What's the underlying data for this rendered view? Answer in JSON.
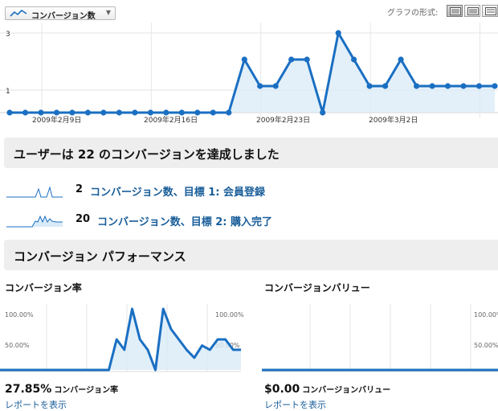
{
  "toolbar": {
    "metric_label": "コンバージョン数",
    "graph_type_label": "グラフの形式:"
  },
  "main_chart": {
    "y_ticks": [
      "3",
      "1"
    ],
    "x_ticks": [
      "2009年2月9日",
      "2009年2月16日",
      "2009年2月23日",
      "2009年3月2日"
    ]
  },
  "summary": {
    "heading": "ユーザーは 22 のコンバージョンを達成しました",
    "goals": [
      {
        "count": "2",
        "label": "コンバージョン数、目標 1: 会員登録"
      },
      {
        "count": "20",
        "label": "コンバージョン数、目標 2: 購入完了"
      }
    ]
  },
  "performance": {
    "heading": "コンバージョン パフォーマンス",
    "rate": {
      "title": "コンバージョン率",
      "tick_top": "100.00%",
      "tick_mid": "50.00%",
      "value": "27.85%",
      "unit": "コンバージョン率",
      "link": "レポートを表示"
    },
    "value": {
      "title": "コンバージョンバリュー",
      "tick_top": "100.00%",
      "tick_mid": "50.00%",
      "value": "$0.00",
      "unit": "コンバージョンバリュー",
      "link": "レポートを表示"
    }
  },
  "chart_data": [
    {
      "type": "area",
      "title": "",
      "xlabel": "",
      "ylabel": "",
      "x_tick_labels": [
        "2009年2月9日",
        "2009年2月16日",
        "2009年2月23日",
        "2009年3月2日"
      ],
      "ylim": [
        0,
        3
      ],
      "series": [
        {
          "values": [
            0,
            0,
            0,
            0,
            0,
            0,
            0,
            0,
            0,
            0,
            0,
            0,
            0,
            0,
            0,
            2,
            1,
            1,
            2,
            2,
            0,
            3,
            2,
            1,
            1,
            2,
            1,
            1,
            1,
            1,
            1,
            1
          ]
        }
      ]
    },
    {
      "type": "area",
      "title": "コンバージョン率",
      "ylim": [
        0,
        100
      ],
      "y_tick_labels": [
        "100.00%",
        "50.00%"
      ],
      "series": [
        {
          "values": [
            0,
            0,
            0,
            0,
            0,
            0,
            0,
            0,
            0,
            0,
            0,
            0,
            0,
            0,
            0,
            50,
            33,
            100,
            50,
            33,
            0,
            100,
            67,
            50,
            33,
            20,
            40,
            33,
            50,
            50,
            33,
            33
          ]
        }
      ]
    },
    {
      "type": "area",
      "title": "コンバージョンバリュー",
      "ylim": [
        0,
        100
      ],
      "y_tick_labels": [
        "100.00%",
        "50.00%"
      ],
      "series": [
        {
          "values": [
            0,
            0,
            0,
            0,
            0,
            0,
            0,
            0,
            0,
            0,
            0,
            0,
            0,
            0,
            0,
            0,
            0,
            0,
            0,
            0,
            0,
            0,
            0,
            0,
            0,
            0,
            0,
            0,
            0,
            0,
            0,
            0
          ]
        }
      ]
    }
  ]
}
